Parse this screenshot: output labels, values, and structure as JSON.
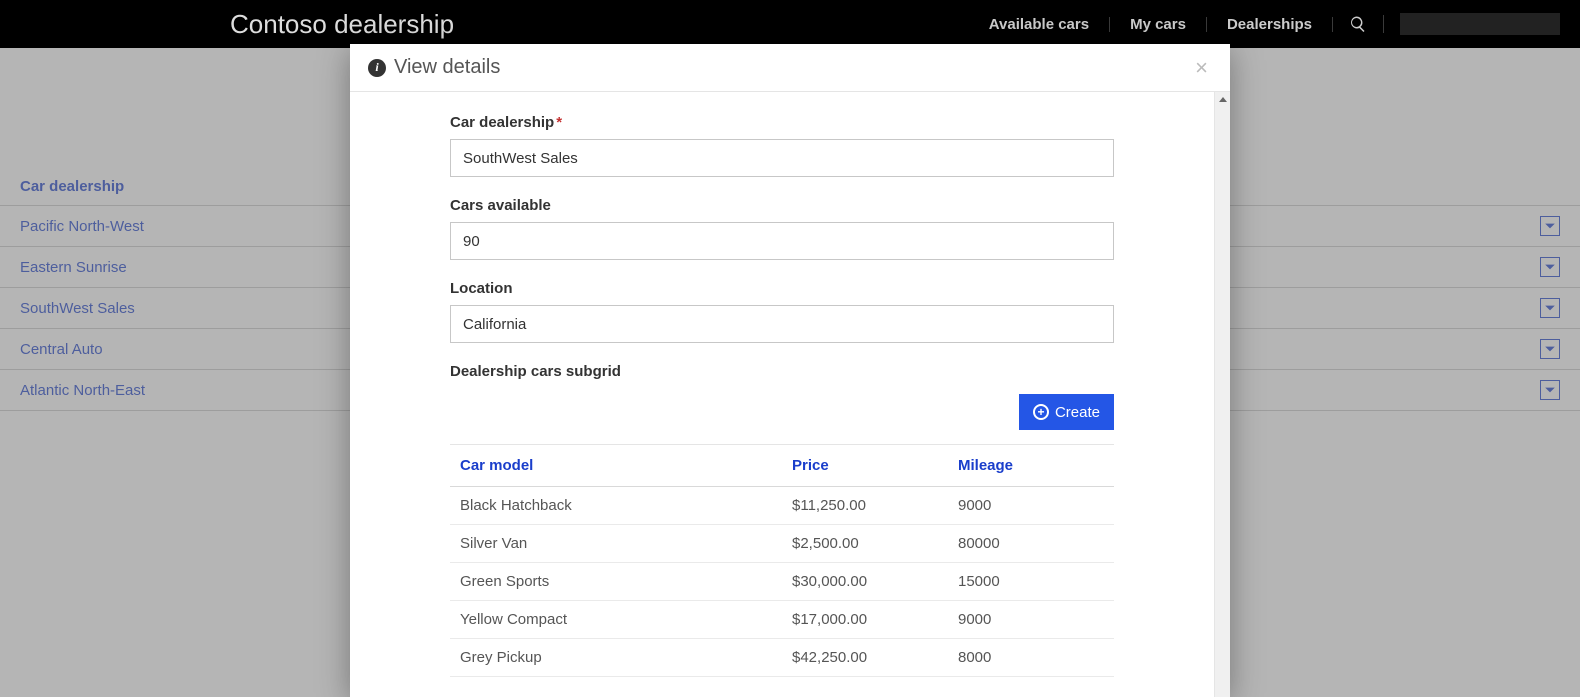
{
  "header": {
    "brand": "Contoso dealership",
    "nav": {
      "available_cars": "Available cars",
      "my_cars": "My cars",
      "dealerships": "Dealerships"
    }
  },
  "list": {
    "heading": "Car dealership",
    "rows": [
      {
        "name": "Pacific North-West"
      },
      {
        "name": "Eastern Sunrise"
      },
      {
        "name": "SouthWest Sales"
      },
      {
        "name": "Central Auto"
      },
      {
        "name": "Atlantic North-East"
      }
    ]
  },
  "modal": {
    "title": "View details",
    "fields": {
      "dealership": {
        "label": "Car dealership",
        "value": "SouthWest Sales"
      },
      "cars_available": {
        "label": "Cars available",
        "value": "90"
      },
      "location": {
        "label": "Location",
        "value": "California"
      }
    },
    "subgrid": {
      "label": "Dealership cars subgrid",
      "create_label": "Create",
      "columns": {
        "model": "Car model",
        "price": "Price",
        "mileage": "Mileage"
      },
      "rows": [
        {
          "model": "Black Hatchback",
          "price": "$11,250.00",
          "mileage": "9000"
        },
        {
          "model": "Silver Van",
          "price": "$2,500.00",
          "mileage": "80000"
        },
        {
          "model": "Green Sports",
          "price": "$30,000.00",
          "mileage": "15000"
        },
        {
          "model": "Yellow Compact",
          "price": "$17,000.00",
          "mileage": "9000"
        },
        {
          "model": "Grey Pickup",
          "price": "$42,250.00",
          "mileage": "8000"
        }
      ]
    }
  }
}
